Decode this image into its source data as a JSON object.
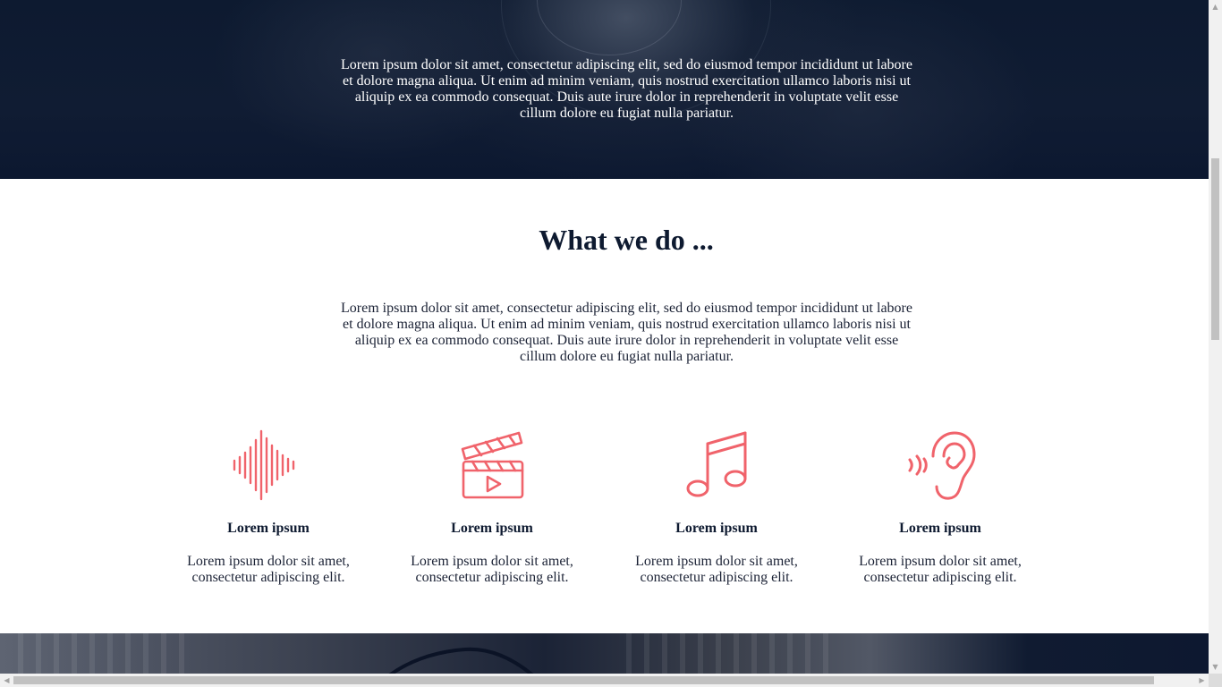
{
  "hero": {
    "paragraph": "Lorem ipsum dolor sit amet, consectetur adipiscing elit, sed do eiusmod tempor incididunt ut labore et dolore magna aliqua. Ut enim ad minim veniam, quis nostrud exercitation ullamco laboris nisi ut aliquip ex ea commodo consequat. Duis aute irure dolor in reprehenderit in voluptate velit esse cillum dolore eu fugiat nulla pariatur."
  },
  "what_we_do": {
    "title": "What we do ...",
    "paragraph": "Lorem ipsum dolor sit amet, consectetur adipiscing elit, sed do eiusmod tempor incididunt ut labore et dolore magna aliqua. Ut enim ad minim veniam, quis nostrud exercitation ullamco laboris nisi ut aliquip ex ea commodo consequat. Duis aute irure dolor in reprehenderit in voluptate velit esse cillum dolore eu fugiat nulla pariatur.",
    "features": [
      {
        "icon": "sound-wave-icon",
        "title": "Lorem ipsum",
        "text": "Lorem ipsum dolor sit amet, consectetur adipiscing elit."
      },
      {
        "icon": "clapperboard-video-icon",
        "title": "Lorem ipsum",
        "text": "Lorem ipsum dolor sit amet, consectetur adipiscing elit."
      },
      {
        "icon": "music-note-icon",
        "title": "Lorem ipsum",
        "text": "Lorem ipsum dolor sit amet, consectetur adipiscing elit."
      },
      {
        "icon": "ear-hearing-icon",
        "title": "Lorem ipsum",
        "text": "Lorem ipsum dolor sit amet, consectetur adipiscing elit."
      }
    ]
  },
  "colors": {
    "accent": "#f0636b",
    "dark_band": "#0d1a30",
    "heading": "#0e1a30"
  }
}
